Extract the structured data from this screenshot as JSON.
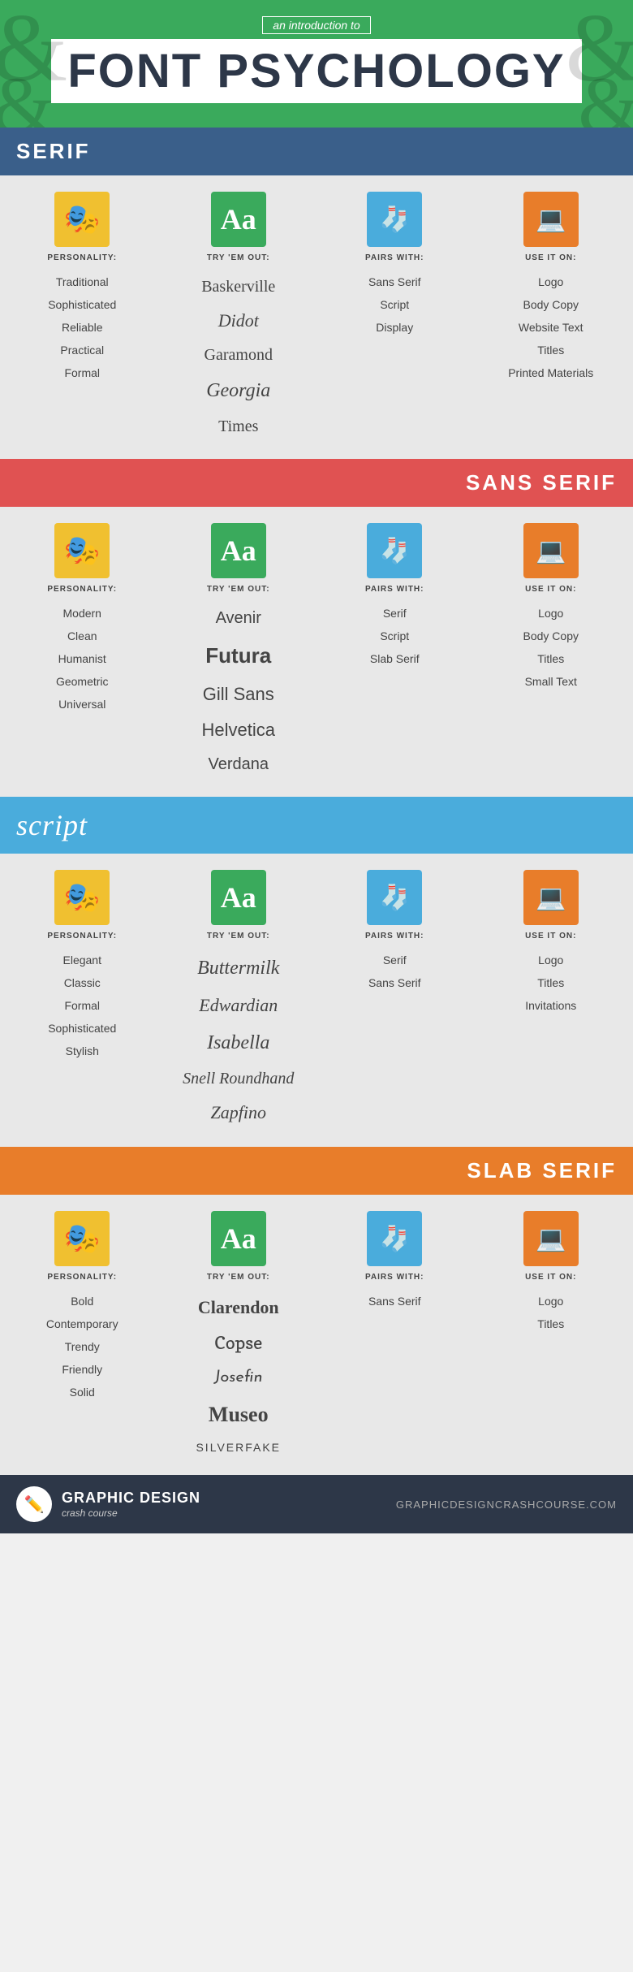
{
  "header": {
    "subtitle": "an introduction to",
    "title": "FONT PSYCHOLOGY"
  },
  "sections": [
    {
      "id": "serif",
      "name": "SERIF",
      "headerClass": "serif-header",
      "columns": [
        {
          "id": "personality",
          "iconType": "personality",
          "label": "PERSONALITY:",
          "items": [
            "Traditional",
            "Sophisticated",
            "Reliable",
            "Practical",
            "Formal"
          ]
        },
        {
          "id": "tryem",
          "iconType": "tryon",
          "label": "TRY 'EM OUT:",
          "items": [
            {
              "text": "Baskerville",
              "class": "font-baskerville"
            },
            {
              "text": "Didot",
              "class": "font-didot"
            },
            {
              "text": "Garamond",
              "class": "font-garamond"
            },
            {
              "text": "Georgia",
              "class": "font-georgia"
            },
            {
              "text": "Times",
              "class": "font-times"
            }
          ]
        },
        {
          "id": "pairswith",
          "iconType": "pairs",
          "label": "PAIRS WITH:",
          "items": [
            "Sans Serif",
            "Script",
            "Display"
          ]
        },
        {
          "id": "useiton",
          "iconType": "useon",
          "label": "USE IT ON:",
          "items": [
            "Logo",
            "Body Copy",
            "Website Text",
            "Titles",
            "Printed Materials"
          ]
        }
      ]
    },
    {
      "id": "sansserif",
      "name": "SANS SERIF",
      "headerClass": "sans-header",
      "columns": [
        {
          "id": "personality",
          "iconType": "personality",
          "label": "PERSONALITY:",
          "items": [
            "Modern",
            "Clean",
            "Humanist",
            "Geometric",
            "Universal"
          ]
        },
        {
          "id": "tryem",
          "iconType": "tryon",
          "label": "TRY 'EM OUT:",
          "items": [
            {
              "text": "Avenir",
              "class": "font-avenir"
            },
            {
              "text": "Futura",
              "class": "font-futura"
            },
            {
              "text": "Gill Sans",
              "class": "font-gillsans"
            },
            {
              "text": "Helvetica",
              "class": "font-helvetica"
            },
            {
              "text": "Verdana",
              "class": "font-verdana"
            }
          ]
        },
        {
          "id": "pairswith",
          "iconType": "pairs",
          "label": "PAIRS WITH:",
          "items": [
            "Serif",
            "Script",
            "Slab Serif"
          ]
        },
        {
          "id": "useiton",
          "iconType": "useon",
          "label": "USE IT ON:",
          "items": [
            "Logo",
            "Body Copy",
            "Titles",
            "Small Text"
          ]
        }
      ]
    },
    {
      "id": "script",
      "name": "script",
      "headerClass": "script-header",
      "columns": [
        {
          "id": "personality",
          "iconType": "personality",
          "label": "PERSONALITY:",
          "items": [
            "Elegant",
            "Classic",
            "Formal",
            "Sophisticated",
            "Stylish"
          ]
        },
        {
          "id": "tryem",
          "iconType": "tryon",
          "label": "TRY 'EM OUT:",
          "items": [
            {
              "text": "Buttermilk",
              "class": "font-buttermilk"
            },
            {
              "text": "Edwardian",
              "class": "font-edwardian"
            },
            {
              "text": "Isabella",
              "class": "font-isabella"
            },
            {
              "text": "Snell Roundhand",
              "class": "font-snell"
            },
            {
              "text": "Zapfino",
              "class": "font-zapfino"
            }
          ]
        },
        {
          "id": "pairswith",
          "iconType": "pairs",
          "label": "PAIRS WITH:",
          "items": [
            "Serif",
            "Sans Serif"
          ]
        },
        {
          "id": "useiton",
          "iconType": "useon",
          "label": "USE IT ON:",
          "items": [
            "Logo",
            "Titles",
            "Invitations"
          ]
        }
      ]
    },
    {
      "id": "slabserif",
      "name": "SLAB SERIF",
      "headerClass": "slab-header",
      "columns": [
        {
          "id": "personality",
          "iconType": "personality",
          "label": "PERSONALITY:",
          "items": [
            "Bold",
            "Contemporary",
            "Trendy",
            "Friendly",
            "Solid"
          ]
        },
        {
          "id": "tryem",
          "iconType": "tryon",
          "label": "TRY 'EM OUT:",
          "items": [
            {
              "text": "Clarendon",
              "class": "font-clarendon"
            },
            {
              "text": "Copse",
              "class": "font-copse"
            },
            {
              "text": "Josefin",
              "class": "font-josefin"
            },
            {
              "text": "Museo",
              "class": "font-museo"
            },
            {
              "text": "SILVERFAKE",
              "class": "font-silverfake"
            }
          ]
        },
        {
          "id": "pairswith",
          "iconType": "pairs",
          "label": "PAIRS WITH:",
          "items": [
            "Sans Serif"
          ]
        },
        {
          "id": "useiton",
          "iconType": "useon",
          "label": "USE IT ON:",
          "items": [
            "Logo",
            "Titles"
          ]
        }
      ]
    }
  ],
  "footer": {
    "brandName": "GRAPHIC DESIGN",
    "brandSub": "crash course",
    "url": "GRAPHICDESIGNCRASHCOURSE.COM"
  }
}
